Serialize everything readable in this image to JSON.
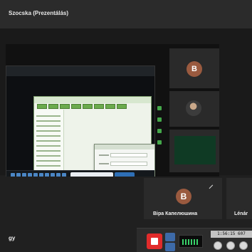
{
  "window": {
    "title": "Szocska (Prezentálás)"
  },
  "participants": [
    {
      "initial": "B",
      "name": "",
      "colors": {
        "avatar": "#9a5a3f"
      }
    },
    {
      "initial": "",
      "name": ""
    },
    {
      "initial": "",
      "name": ""
    },
    {
      "initial": "B",
      "name": "Віра Капелюшина",
      "colors": {
        "avatar": "#9a5a3f"
      }
    },
    {
      "initial": "",
      "name": "Lénár"
    }
  ],
  "presenter": {
    "name": "gy"
  },
  "toolbar": {
    "time": "1:56:15 607"
  }
}
